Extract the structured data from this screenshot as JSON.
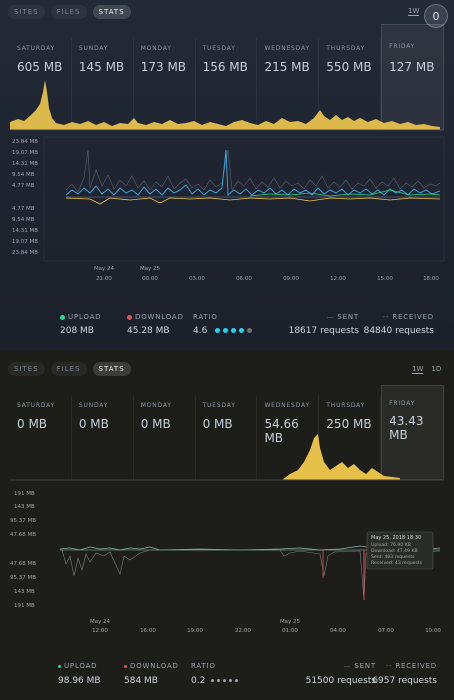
{
  "tabs": [
    {
      "label": "SITES"
    },
    {
      "label": "FILES"
    },
    {
      "label": "STATS"
    }
  ],
  "top": {
    "range_options": [
      "1W"
    ],
    "avatar_text": "0",
    "days": [
      {
        "name": "SATURDAY",
        "value": "605 MB"
      },
      {
        "name": "SUNDAY",
        "value": "145 MB"
      },
      {
        "name": "MONDAY",
        "value": "173 MB"
      },
      {
        "name": "TUESDAY",
        "value": "156 MB"
      },
      {
        "name": "WEDNESDAY",
        "value": "215 MB"
      },
      {
        "name": "THURSDAY",
        "value": "550 MB"
      },
      {
        "name": "FRIDAY",
        "value": "127 MB"
      }
    ],
    "y_labels_up": [
      "23.84 MB",
      "19.07 MB",
      "14.31 MB",
      "9.54 MB",
      "4.77 MB"
    ],
    "y_labels_down": [
      "4.77 MB",
      "9.54 MB",
      "14.31 MB",
      "19.07 MB",
      "23.84 MB"
    ],
    "x_dates": [
      "May 24",
      "May 25"
    ],
    "x_labels": [
      "21:00",
      "00:00",
      "03:00",
      "06:00",
      "09:00",
      "12:00",
      "15:00",
      "18:00"
    ],
    "upload_label": "UPLOAD",
    "upload_value": "208 MB",
    "download_label": "DOWNLOAD",
    "download_value": "45.28 MB",
    "ratio_label": "RATIO",
    "ratio_value": "4.6",
    "sent_label": "SENT",
    "sent_value": "18617 requests",
    "received_label": "RECEIVED",
    "received_value": "84840 requests",
    "colors": {
      "upload": "#27d98a",
      "download": "#d9534f",
      "accent": "#f2c94c",
      "ratio": "#22d3ee"
    }
  },
  "bottom": {
    "range_options": [
      "1W",
      "1D"
    ],
    "days": [
      {
        "name": "SATURDAY",
        "value": "0 MB"
      },
      {
        "name": "SUNDAY",
        "value": "0 MB"
      },
      {
        "name": "MONDAY",
        "value": "0 MB"
      },
      {
        "name": "TUESDAY",
        "value": "0 MB"
      },
      {
        "name": "WEDNESDAY",
        "value": "54.66 MB"
      },
      {
        "name": "THURSDAY",
        "value": "250 MB"
      },
      {
        "name": "FRIDAY",
        "value": "43.43 MB"
      }
    ],
    "y_labels_up": [
      "191 MB",
      "143 MB",
      "95.37 MB",
      "47.68 MB"
    ],
    "y_labels_down": [
      "47.68 MB",
      "95.37 MB",
      "143 MB",
      "191 MB"
    ],
    "x_dates": [
      "May 24",
      "May 25"
    ],
    "x_labels": [
      "12:00",
      "16:00",
      "19:00",
      "22:00",
      "01:00",
      "04:00",
      "07:00",
      "10:00"
    ],
    "tooltip": {
      "title": "May 25, 2018 18:30",
      "upload": "Upload: 76.90 KB",
      "download": "Download: 47.49 KB",
      "sent": "Sent: 483 requests",
      "received": "Received: 43 requests"
    },
    "upload_label": "UPLOAD",
    "upload_value": "98.96 MB",
    "download_label": "DOWNLOAD",
    "download_value": "584 MB",
    "ratio_label": "RATIO",
    "ratio_value": "0.2",
    "sent_label": "SENT",
    "sent_value": "51500 requests",
    "received_label": "RECEIVED",
    "received_value": "6957 requests",
    "colors": {
      "upload": "#27d98a",
      "download": "#d9534f",
      "accent": "#f2c94c",
      "ratio": "#9ca3af"
    }
  }
}
